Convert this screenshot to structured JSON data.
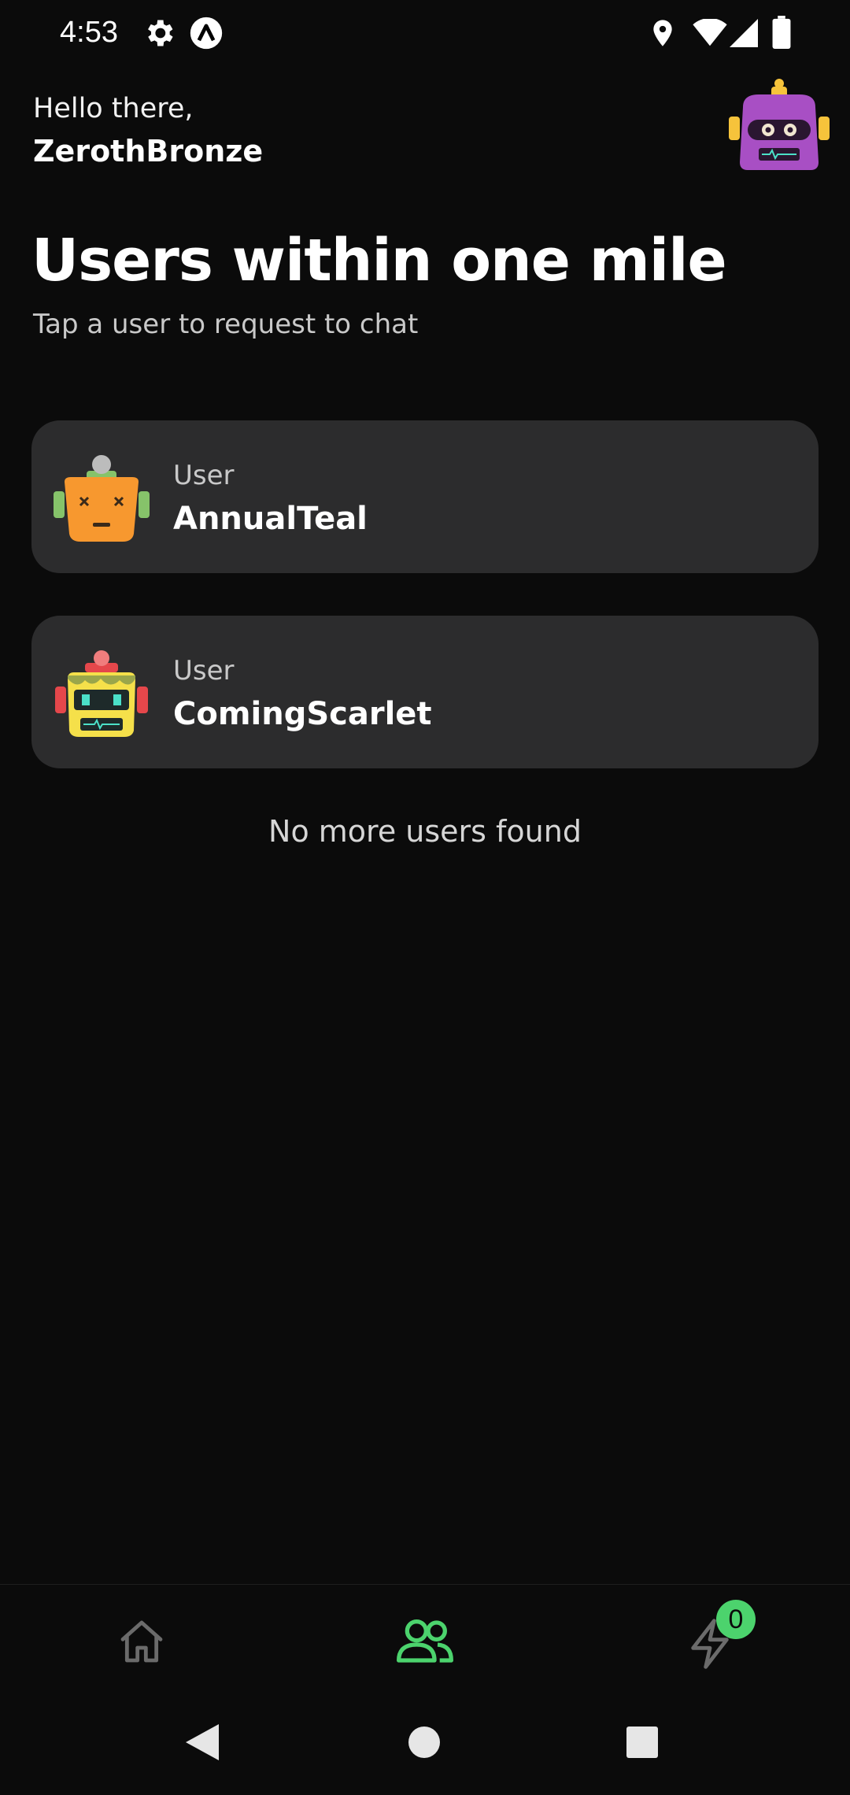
{
  "status_bar": {
    "time": "4:53",
    "icons": [
      "gear-icon",
      "app-a-icon",
      "location-icon",
      "wifi-icon",
      "signal-icon",
      "battery-icon"
    ]
  },
  "header": {
    "greeting": "Hello there,",
    "username": "ZerothBronze",
    "avatar": "purple-robot-avatar"
  },
  "main": {
    "title": "Users within one mile",
    "subtitle": "Tap a user to request to chat",
    "users": [
      {
        "label": "User",
        "name": "AnnualTeal",
        "avatar": "orange-robot-avatar"
      },
      {
        "label": "User",
        "name": "ComingScarlet",
        "avatar": "yellow-robot-avatar"
      }
    ],
    "empty_message": "No more users found"
  },
  "bottom_nav": {
    "items": [
      {
        "icon": "home-icon",
        "active": false
      },
      {
        "icon": "users-icon",
        "active": true
      },
      {
        "icon": "lightning-icon",
        "active": false
      }
    ],
    "badge_count": "0",
    "accent_color": "#4cd36d"
  },
  "system_nav": [
    "back-icon",
    "home-circle-icon",
    "recents-icon"
  ]
}
